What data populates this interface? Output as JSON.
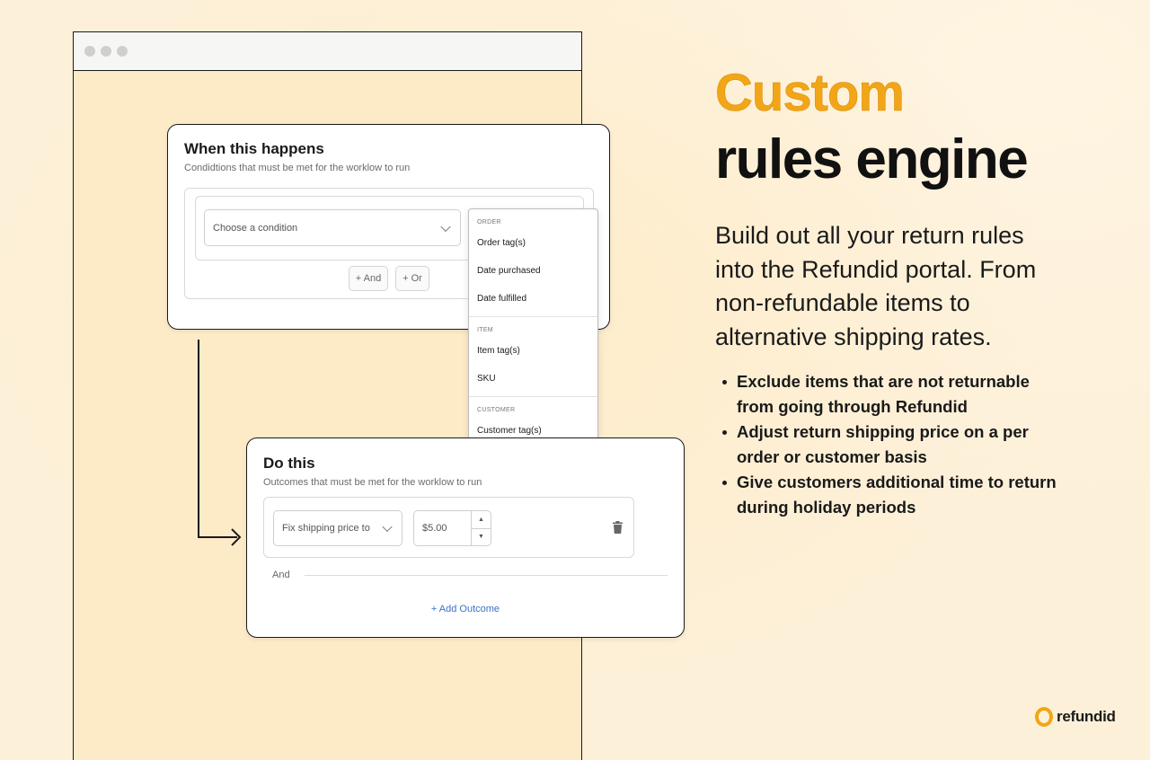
{
  "hero": {
    "line1": "Custom",
    "line2": "rules engine"
  },
  "lead": "Build out all your return rules into the Refundid portal. From non-refundable items to alternative shipping rates.",
  "bullets": [
    "Exclude items that are not returnable from going through Refundid",
    "Adjust return shipping price on a per order or customer basis",
    "Give customers additional time to return during holiday periods"
  ],
  "when_card": {
    "title": "When this happens",
    "subtitle": "Condidtions that must be met for the worklow to run",
    "select_placeholder": "Choose a condition",
    "and_button": "+ And",
    "or_button": "+ Or"
  },
  "dropdown": {
    "groups": [
      {
        "heading": "ORDER",
        "items": [
          "Order tag(s)",
          "Date purchased",
          "Date fulfilled"
        ]
      },
      {
        "heading": "ITEM",
        "items": [
          "Item tag(s)",
          "SKU"
        ]
      },
      {
        "heading": "CUSTOMER",
        "items": [
          "Customer tag(s)"
        ]
      }
    ]
  },
  "do_card": {
    "title": "Do this",
    "subtitle": "Outcomes that must be met for the worklow to run",
    "action_select": "Fix shipping price to",
    "price_value": "$5.00",
    "and_label": "And",
    "add_outcome": "+ Add Outcome"
  },
  "logo": {
    "text": "refundid"
  },
  "colors": {
    "accent": "#f2a516",
    "background": "#fdf0d8",
    "link": "#3b73c4"
  }
}
